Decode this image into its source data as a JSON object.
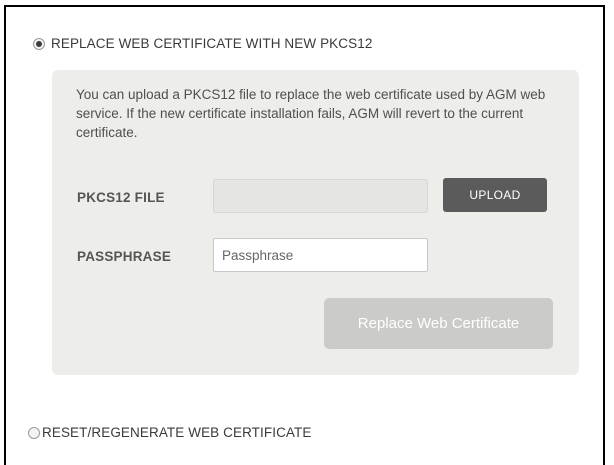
{
  "options": {
    "replace": {
      "label": "REPLACE WEB CERTIFICATE WITH NEW PKCS12",
      "checked": true
    },
    "reset": {
      "label": "RESET/REGENERATE WEB CERTIFICATE",
      "checked": false
    }
  },
  "panel": {
    "description": "You can upload a PKCS12 file to replace the web certificate used by AGM web service. If the new certificate installation fails, AGM will revert to the current certificate."
  },
  "form": {
    "pkcs12_label": "PKCS12 FILE",
    "pkcs12_value": "",
    "upload_label": "UPLOAD",
    "passphrase_label": "PASSPHRASE",
    "passphrase_placeholder": "Passphrase",
    "passphrase_value": "",
    "submit_label": "Replace Web Certificate"
  },
  "colors": {
    "panel_bg": "#ededea",
    "upload_button": "#5b5b5b",
    "submit_button_disabled": "#cbcbc8"
  }
}
